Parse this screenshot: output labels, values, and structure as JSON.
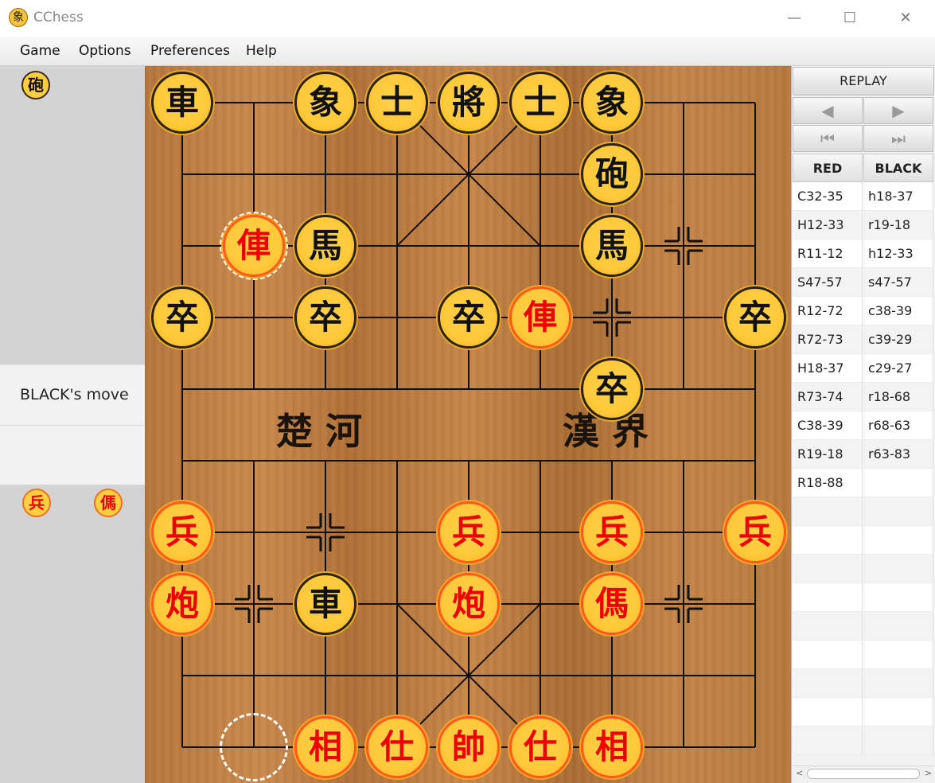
{
  "window": {
    "title": "CChess",
    "app_icon": "象",
    "minimize": "—",
    "maximize": "☐",
    "close": "✕"
  },
  "menu": [
    "Game",
    "Options",
    "Preferences",
    "Help"
  ],
  "left": {
    "captured_black": [
      "砲"
    ],
    "status": "BLACK's move",
    "captured_red": [
      "兵",
      "傌"
    ]
  },
  "board": {
    "river_left": "楚 河",
    "river_right": "漢 界",
    "pieces": [
      {
        "c": "車",
        "side": "black",
        "col": 0,
        "row": 0
      },
      {
        "c": "象",
        "side": "black",
        "col": 2,
        "row": 0
      },
      {
        "c": "士",
        "side": "black",
        "col": 3,
        "row": 0
      },
      {
        "c": "將",
        "side": "black",
        "col": 4,
        "row": 0
      },
      {
        "c": "士",
        "side": "black",
        "col": 5,
        "row": 0
      },
      {
        "c": "象",
        "side": "black",
        "col": 6,
        "row": 0
      },
      {
        "c": "砲",
        "side": "black",
        "col": 6,
        "row": 1
      },
      {
        "c": "俥",
        "side": "red",
        "col": 1,
        "row": 2
      },
      {
        "c": "馬",
        "side": "black",
        "col": 2,
        "row": 2
      },
      {
        "c": "馬",
        "side": "black",
        "col": 6,
        "row": 2
      },
      {
        "c": "卒",
        "side": "black",
        "col": 0,
        "row": 3
      },
      {
        "c": "卒",
        "side": "black",
        "col": 2,
        "row": 3
      },
      {
        "c": "卒",
        "side": "black",
        "col": 4,
        "row": 3
      },
      {
        "c": "俥",
        "side": "red",
        "col": 5,
        "row": 3
      },
      {
        "c": "卒",
        "side": "black",
        "col": 8,
        "row": 3
      },
      {
        "c": "卒",
        "side": "black",
        "col": 6,
        "row": 4
      },
      {
        "c": "兵",
        "side": "red",
        "col": 0,
        "row": 6
      },
      {
        "c": "兵",
        "side": "red",
        "col": 4,
        "row": 6
      },
      {
        "c": "兵",
        "side": "red",
        "col": 6,
        "row": 6
      },
      {
        "c": "兵",
        "side": "red",
        "col": 8,
        "row": 6
      },
      {
        "c": "炮",
        "side": "red",
        "col": 0,
        "row": 7
      },
      {
        "c": "車",
        "side": "black",
        "col": 2,
        "row": 7
      },
      {
        "c": "炮",
        "side": "red",
        "col": 4,
        "row": 7
      },
      {
        "c": "傌",
        "side": "red",
        "col": 6,
        "row": 7
      },
      {
        "c": "相",
        "side": "red",
        "col": 2,
        "row": 9
      },
      {
        "c": "仕",
        "side": "red",
        "col": 3,
        "row": 9
      },
      {
        "c": "帥",
        "side": "red",
        "col": 4,
        "row": 9
      },
      {
        "c": "仕",
        "side": "red",
        "col": 5,
        "row": 9
      },
      {
        "c": "相",
        "side": "red",
        "col": 6,
        "row": 9
      }
    ],
    "last_move": {
      "from": {
        "col": 1,
        "row": 9
      },
      "to": {
        "col": 1,
        "row": 2
      }
    }
  },
  "right": {
    "replay_label": "REPLAY",
    "nav": {
      "prev": "◀",
      "next": "▶",
      "first": "⏮",
      "last": "⏭"
    },
    "headers": [
      "RED",
      "BLACK"
    ],
    "moves": [
      [
        "C32-35",
        "h18-37"
      ],
      [
        "H12-33",
        "r19-18"
      ],
      [
        "R11-12",
        "h12-33"
      ],
      [
        "S47-57",
        "s47-57"
      ],
      [
        "R12-72",
        "c38-39"
      ],
      [
        "R72-73",
        "c39-29"
      ],
      [
        "H18-37",
        "c29-27"
      ],
      [
        "R73-74",
        "r18-68"
      ],
      [
        "C38-39",
        "r68-63"
      ],
      [
        "R19-18",
        "r63-83"
      ],
      [
        "R18-88",
        ""
      ]
    ]
  }
}
